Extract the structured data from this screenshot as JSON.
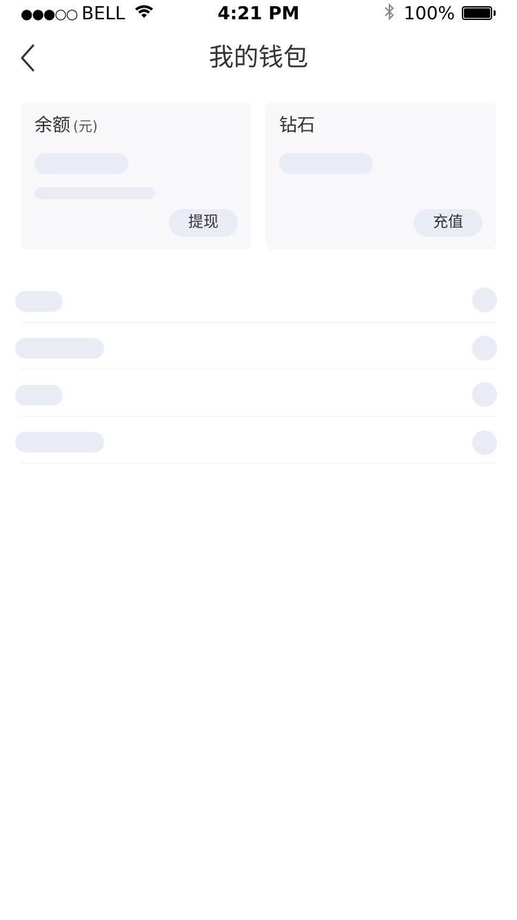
{
  "status_bar": {
    "signal": "●●●○○",
    "carrier": "BELL",
    "time": "4:21 PM",
    "battery_text": "100%",
    "icons": [
      "wifi-icon",
      "bluetooth-icon",
      "battery-icon"
    ]
  },
  "nav": {
    "title": "我的钱包",
    "back_icon": "chevron-left-icon"
  },
  "cards": {
    "balance": {
      "title": "余额",
      "unit": "(元)",
      "button": "提现"
    },
    "diamond": {
      "title": "钻石",
      "button": "充值"
    }
  },
  "colors": {
    "card_bg": "#f8f8fa",
    "skeleton": "#e9ebf5",
    "text": "#333333"
  }
}
